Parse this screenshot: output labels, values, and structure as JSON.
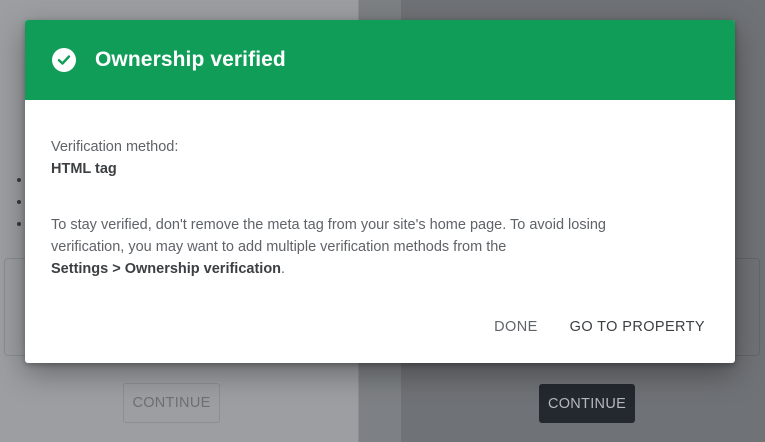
{
  "background": {
    "left_button_label": "CONTINUE",
    "right_button_label": "CONTINUE"
  },
  "dialog": {
    "title": "Ownership verified",
    "header_color": "#0f9d58",
    "icon": "check-circle-icon",
    "method_label": "Verification method:",
    "method_value": "HTML tag",
    "message_text": "To stay verified, don't remove the meta tag from your site's home page. To avoid losing verification, you may want to add multiple verification methods from the",
    "message_link": "Settings > Ownership verification",
    "message_end": ".",
    "done_label": "DONE",
    "go_to_property_label": "GO TO PROPERTY"
  }
}
